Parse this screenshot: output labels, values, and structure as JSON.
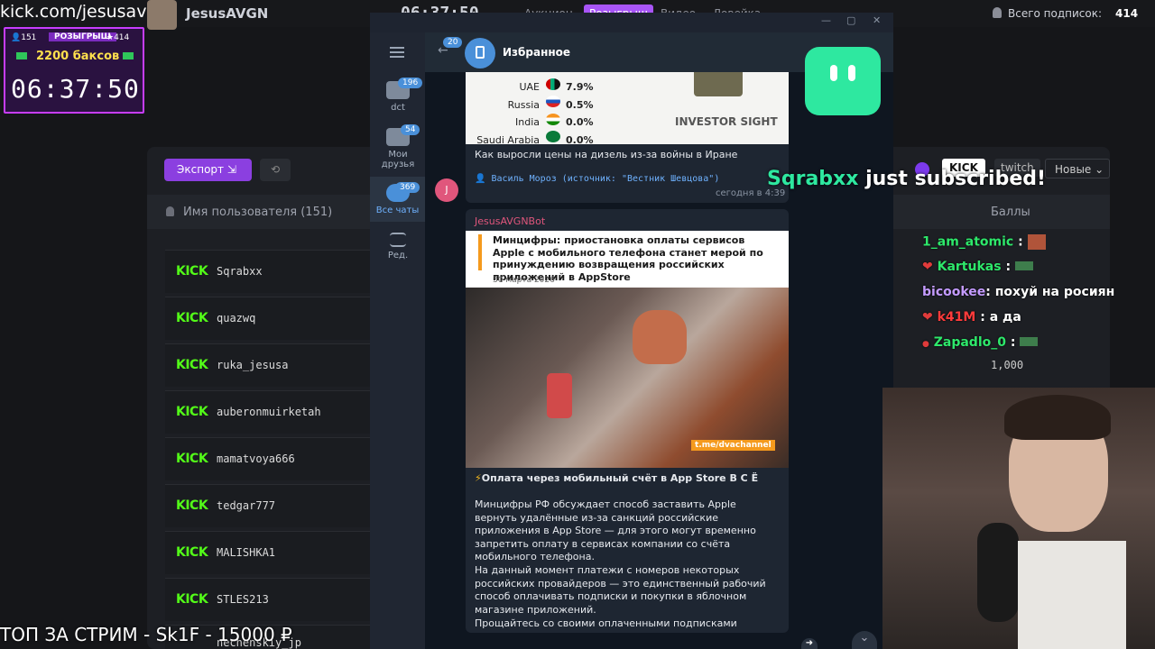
{
  "overlay": {
    "streamer_url": "kick.com/jesusavgn",
    "giveaway": {
      "count_left": "151",
      "label": "РОЗЫГРЫШ",
      "count_right": "414",
      "prize": "2200 баксов",
      "timer": "06:37:50"
    },
    "top_donate": "ТОП ЗА СТРИМ - Sk1F - 15000 ₽",
    "subscribed_alert": {
      "user": "Sqrabxx",
      "rest": "just subscribed!"
    }
  },
  "dashboard": {
    "channel_name": "JesusAVGN",
    "top_timer": "06:37:50",
    "tabs": [
      "Аукцион",
      "Розыгрыш",
      "Видео",
      "Ловейка"
    ],
    "active_tab": "Розыгрыш",
    "total_subs_label": "Всего подписок:",
    "total_subs": "414",
    "export_label": "Экспорт",
    "platforms": [
      "KICK",
      "twitch"
    ],
    "sort_label": "Новые",
    "col_username": "Имя пользователя (151)",
    "col_points": "Баллы",
    "points_value": "1,000",
    "users": [
      "Sqrabxx",
      "quazwq",
      "ruka_jesusa",
      "auberonmuirketah",
      "mamatvoya666",
      "tedgar777",
      "MALISHKA1",
      "STLES213",
      "nechenskiy_jp"
    ]
  },
  "telegram": {
    "header_title": "Избранное",
    "back_count": "20",
    "folders": [
      {
        "label": "dct",
        "badge": "196"
      },
      {
        "label": "Мои друзья",
        "badge": "54"
      },
      {
        "label": "Все чаты",
        "badge": "369"
      },
      {
        "label": "Ред.",
        "badge": ""
      }
    ],
    "chart_rows": [
      {
        "country": "UAE",
        "value": "7.9%"
      },
      {
        "country": "Russia",
        "value": "0.5%"
      },
      {
        "country": "India",
        "value": "0.0%"
      },
      {
        "country": "Saudi Arabia",
        "value": "0.0%"
      }
    ],
    "investor_logo": "INVESTOR SIGHT",
    "msg1_caption": "Как выросли цены на дизель из-за войны в Иране",
    "msg1_source": "Василь Мороз (источник: \"Вестник Шевцова\")",
    "msg1_time": "сегодня в 4:39",
    "msg2_sender": "JesusAVGNBot",
    "msg2_headline": "Минцифры: приостановка оплаты сервисов Apple с мобильного телефона станет мерой по принуждению возвращения российских приложений в AppStore",
    "msg2_date": "30 марта 2026",
    "msg2_watermark": "t.me/dvachannel",
    "msg2_title": "Оплата через мобильный счёт в App Store В С Ё",
    "msg2_p1": "Минцифры РФ обсуждает способ заставить Apple вернуть удалённые из-за санкций российские приложения в App Store — для этого могут временно запретить оплату в сервисах компании со счёта мобильного телефона.",
    "msg2_p2": "На данный момент платежи с номеров некоторых российских провайдеров — это единственный рабочий способ оплачивать подписки и покупки в яблочном магазине приложений.",
    "msg2_p3": "Прощайтесь со своими оплаченными подписками"
  },
  "chat": [
    {
      "user": "1_am_atomic",
      "text": ":",
      "color": "#2ee86b"
    },
    {
      "user": "Kartukas",
      "text": ":",
      "color": "#2ee86b"
    },
    {
      "user": "bicookee",
      "text": ": похуй на росиян",
      "color": "#c49bff"
    },
    {
      "user": "k41M",
      "text": ": а да",
      "color": "#ff3b3b"
    },
    {
      "user": "Zapadlo_0",
      "text": ":",
      "color": "#2ee86b"
    }
  ]
}
